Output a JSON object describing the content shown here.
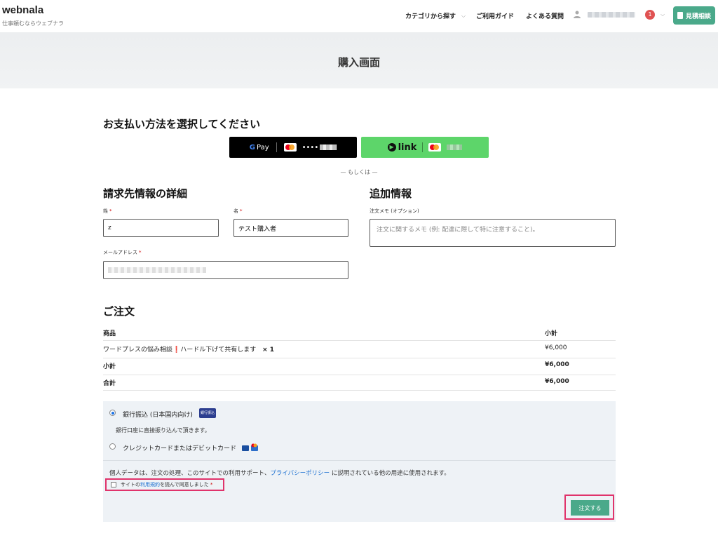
{
  "header": {
    "logo": "webnala",
    "tagline": "仕事頼むならウェブナラ",
    "nav": [
      {
        "label": "カテゴリから探す",
        "has_dropdown": true
      },
      {
        "label": "ご利用ガイド",
        "has_dropdown": false
      },
      {
        "label": "よくある質問",
        "has_dropdown": false
      }
    ],
    "notification_count": "1",
    "quote_button": "見積相談"
  },
  "hero": {
    "title": "購入画面"
  },
  "payment_select": {
    "heading": "お支払い方法を選択してください",
    "gpay_label": "Pay",
    "gpay_card_masked": "••••",
    "link_label": "link",
    "or_text": "— もしくは —"
  },
  "billing": {
    "heading": "請求先情報の詳細",
    "last_name_label": "姓",
    "last_name_value": "z",
    "first_name_label": "名",
    "first_name_value": "テスト購入者",
    "email_label": "メールアドレス",
    "required_mark": "*"
  },
  "additional": {
    "heading": "追加情報",
    "notes_label": "注文メモ (オプション)",
    "notes_placeholder": "注文に関するメモ (例: 配達に際して特に注意すること)。"
  },
  "order": {
    "heading": "ご注文",
    "col_product": "商品",
    "col_subtotal": "小計",
    "items": [
      {
        "name": "ワードプレスの悩み相談❗ハードル下げて共有します",
        "qty": "× 1",
        "price": "¥6,000"
      }
    ],
    "subtotal_label": "小計",
    "subtotal_value": "¥6,000",
    "total_label": "合計",
    "total_value": "¥6,000"
  },
  "payment_methods": {
    "bank_label": "銀行振込 (日本国内向け)",
    "bank_icon_text": "銀行振込",
    "bank_desc": "銀行口座に直接振り込んで頂きます。",
    "card_label": "クレジットカードまたはデビットカード",
    "selected": "bank"
  },
  "privacy": {
    "text_before": "個人データは、注文の処理、このサイトでの利用サポート、",
    "link": "プライバシーポリシー",
    "text_after": " に説明されている他の用途に使用されます。"
  },
  "terms": {
    "before": "サイトの",
    "link": "利用規約",
    "after": "を読んで同意しました",
    "required_mark": "*",
    "checked": false
  },
  "place_order": "注文する",
  "colors": {
    "accent": "#4aa98a",
    "highlight": "#e0336b",
    "link": "#1a6fd1",
    "badge": "#e05252"
  }
}
